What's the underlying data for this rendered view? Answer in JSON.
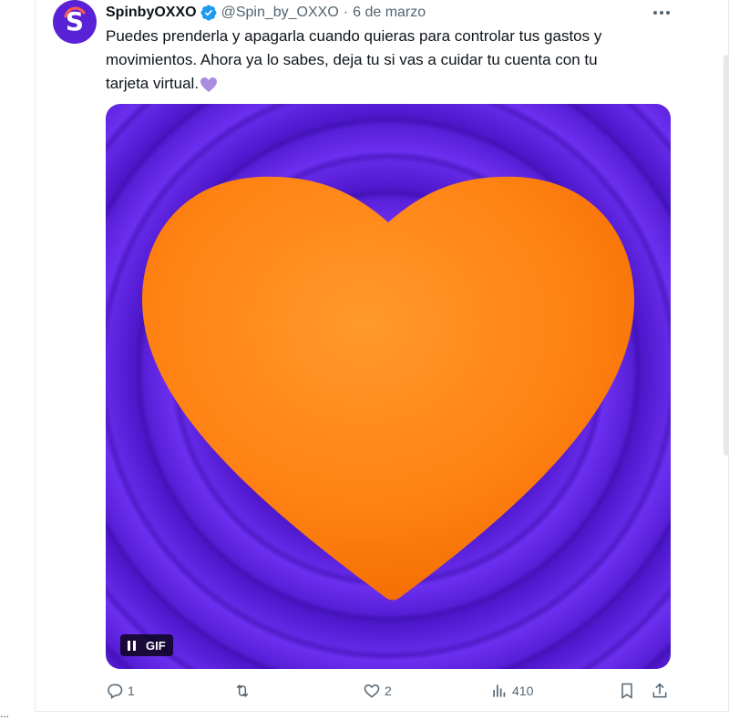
{
  "tweet": {
    "author_name": "SpinbyOXXO",
    "handle": "@Spin_by_OXXO",
    "separator": "·",
    "date": "6 de marzo",
    "text_line1": "Puedes prenderla y apagarla cuando quieras para controlar tus gastos y",
    "text_line2": "movimientos.  Ahora ya lo sabes, deja tu  si vas a cuidar tu cuenta con tu",
    "text_line3": "tarjeta virtual.",
    "avatar_letter": "S",
    "avatar_color": "#5a22d6",
    "verified_color": "#1d9bf0",
    "trailing_emoji": "purple-heart-icon"
  },
  "media": {
    "type_label": "GIF",
    "background_color": "#5a1fd9",
    "heart_color": "#ff7f11"
  },
  "actions": {
    "reply_count": "1",
    "retweet_count": "",
    "like_count": "2",
    "views_count": "410"
  },
  "misc": {
    "corner_dots": "..."
  }
}
